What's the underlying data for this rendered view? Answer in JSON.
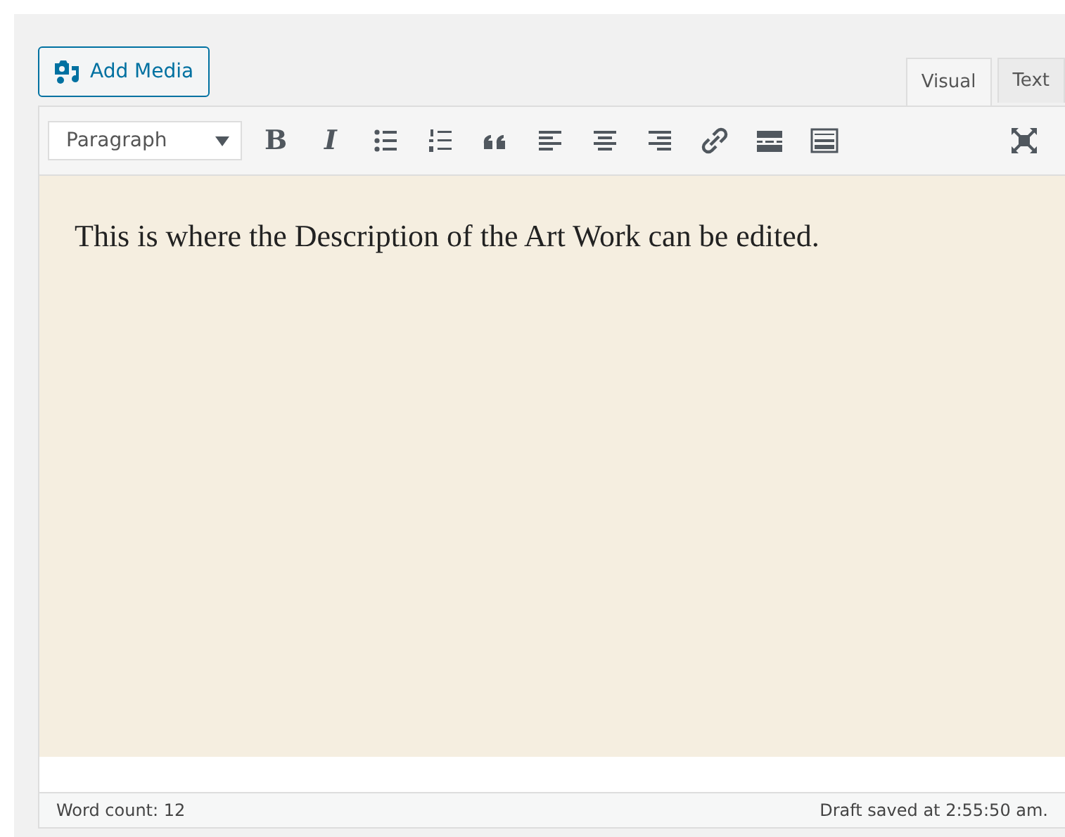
{
  "add_media": {
    "label": "Add Media"
  },
  "tabs": [
    {
      "label": "Visual",
      "selected": true
    },
    {
      "label": "Text",
      "selected": false
    }
  ],
  "format_select": {
    "value": "Paragraph"
  },
  "toolbar": [
    {
      "kind": "bold",
      "label": "B"
    },
    {
      "kind": "italic",
      "label": "I"
    },
    {
      "kind": "bullets"
    },
    {
      "kind": "numbers"
    },
    {
      "kind": "quote"
    },
    {
      "kind": "align-left"
    },
    {
      "kind": "align-center"
    },
    {
      "kind": "align-right"
    },
    {
      "kind": "link"
    },
    {
      "kind": "more"
    },
    {
      "kind": "toolbar-toggle"
    }
  ],
  "content": "This is where the Description of the Art Work can be edited.",
  "status_bar": {
    "word_count": "Word count: 12",
    "draft_saved": "Draft saved at 2:55:50 am."
  }
}
